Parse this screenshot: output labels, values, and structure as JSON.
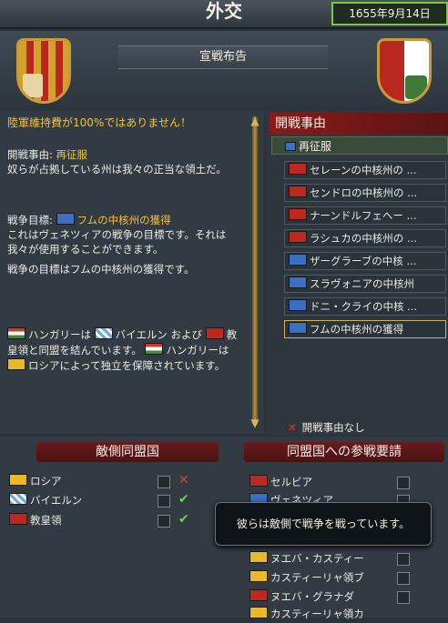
{
  "window": {
    "title": "外交",
    "date": "1655年9月14日"
  },
  "header": {
    "banner": "宣戦布告"
  },
  "info": {
    "warning": "陸軍維持費が100%ではありません！",
    "cb_label": "開戦事由: ",
    "cb_value": "再征服",
    "cb_desc": "奴らが占拠している州は我々の正当な領土だ。",
    "goal_label": "戦争目標: ",
    "goal_value": "フムの中核州の獲得",
    "goal_desc1": "これはヴェネツィアの戦争の目標です。それは我々が使用することができます。",
    "goal_desc2": "戦争の目標はフムの中核州の獲得です。",
    "alliance_1": "ハンガリーは",
    "alliance_2": "バイエルン および",
    "alliance_3": "教皇領と同盟を結んでいます。",
    "alliance_4": "ハンガリーは",
    "alliance_5": "ロシアによって独立を保障されています。"
  },
  "cb_panel": {
    "header": "開戦事由",
    "selected": "再征服",
    "items": [
      "セレーンの中核州の ...",
      "センドロの中核州の ...",
      "ナーンドルフェヘー ...",
      "ラシュカの中核州の ...",
      "ザーグラーブの中核 ...",
      "スラヴォニアの中核州",
      "ドニ・クライの中核 ...",
      "フムの中核州の獲得"
    ],
    "none_label": "開戦事由なし"
  },
  "enemy_allies": {
    "header": "敵側同盟国",
    "rows": [
      {
        "name": "ロシア",
        "mark": "✕"
      },
      {
        "name": "バイエルン",
        "mark": "✔"
      },
      {
        "name": "教皇領",
        "mark": "✔"
      }
    ]
  },
  "call_allies": {
    "header": "同盟国への参戦要請",
    "rows": [
      "セルビア",
      "ヴェネツィア",
      "ヌエバ・カスティー",
      "カスティーリャ領ブ",
      "ヌエバ・グラナダ",
      "カスティーリャ領カ"
    ]
  },
  "tooltip": "彼らは敵側で戦争を戦っています。",
  "colors": {
    "accent_green": "#7fc742",
    "header_red": "#8c1a1a",
    "gold": "#f2c23a"
  }
}
